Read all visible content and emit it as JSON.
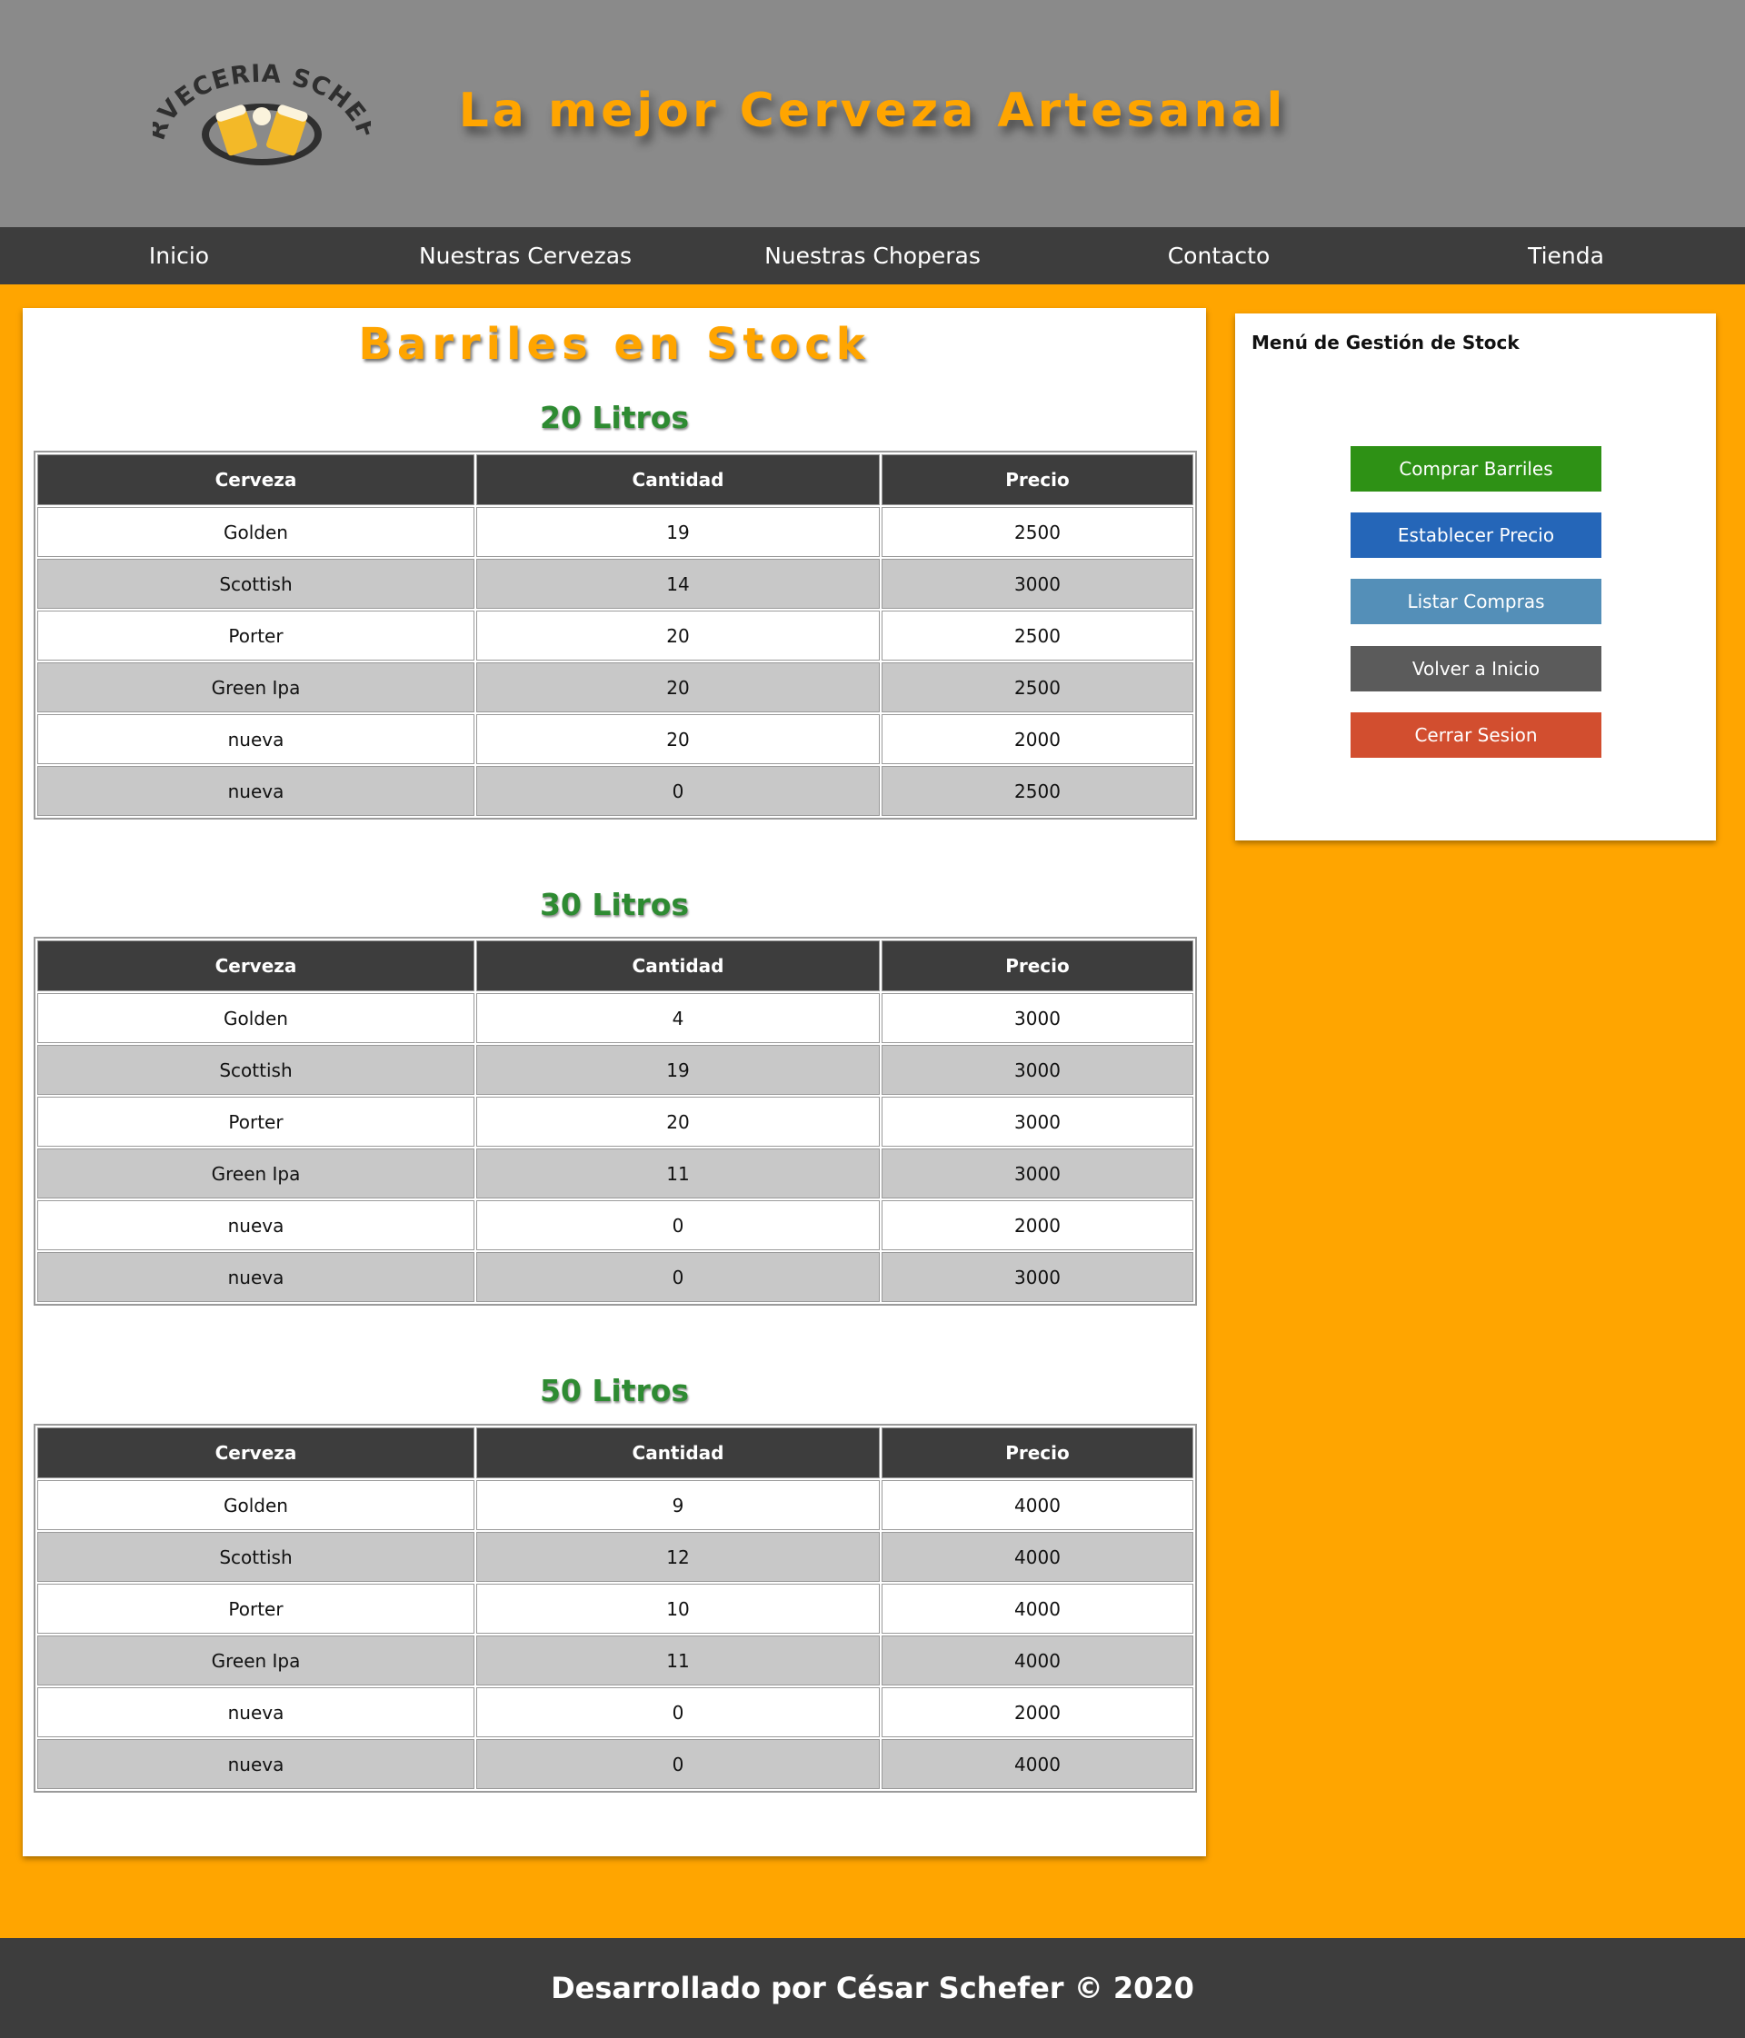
{
  "header": {
    "logo_text": "CERVECERIA SCHEFER",
    "title": "La mejor Cerveza Artesanal"
  },
  "nav": [
    "Inicio",
    "Nuestras Cervezas",
    "Nuestras Choperas",
    "Contacto",
    "Tienda"
  ],
  "main": {
    "title": "Barriles en Stock",
    "columns": [
      "Cerveza",
      "Cantidad",
      "Precio"
    ],
    "sections": [
      {
        "title": "20 Litros",
        "rows": [
          [
            "Golden",
            "19",
            "2500"
          ],
          [
            "Scottish",
            "14",
            "3000"
          ],
          [
            "Porter",
            "20",
            "2500"
          ],
          [
            "Green Ipa",
            "20",
            "2500"
          ],
          [
            "nueva",
            "20",
            "2000"
          ],
          [
            "nueva",
            "0",
            "2500"
          ]
        ]
      },
      {
        "title": "30 Litros",
        "rows": [
          [
            "Golden",
            "4",
            "3000"
          ],
          [
            "Scottish",
            "19",
            "3000"
          ],
          [
            "Porter",
            "20",
            "3000"
          ],
          [
            "Green Ipa",
            "11",
            "3000"
          ],
          [
            "nueva",
            "0",
            "2000"
          ],
          [
            "nueva",
            "0",
            "3000"
          ]
        ]
      },
      {
        "title": "50 Litros",
        "rows": [
          [
            "Golden",
            "9",
            "4000"
          ],
          [
            "Scottish",
            "12",
            "4000"
          ],
          [
            "Porter",
            "10",
            "4000"
          ],
          [
            "Green Ipa",
            "11",
            "4000"
          ],
          [
            "nueva",
            "0",
            "2000"
          ],
          [
            "nueva",
            "0",
            "4000"
          ]
        ]
      }
    ]
  },
  "sidebar": {
    "title": "Menú de Gestión de Stock",
    "buttons": [
      {
        "label": "Comprar Barriles",
        "color": "#2e9115"
      },
      {
        "label": "Establecer Precio",
        "color": "#2566b8"
      },
      {
        "label": "Listar Compras",
        "color": "#548fb8"
      },
      {
        "label": "Volver a Inicio",
        "color": "#5b5b5b"
      },
      {
        "label": "Cerrar Sesion",
        "color": "#d24e2f"
      }
    ]
  },
  "footer": {
    "text": "Desarrollado por César Schefer © 2020"
  },
  "colors": {
    "background": "#FFA500",
    "header": "#8a8a8a",
    "navbar": "#3d3d3d",
    "title": "#FFA500",
    "section_title": "#2e8b32",
    "table_header": "#3d3d3d",
    "row_alt": "#c8c8c8"
  }
}
